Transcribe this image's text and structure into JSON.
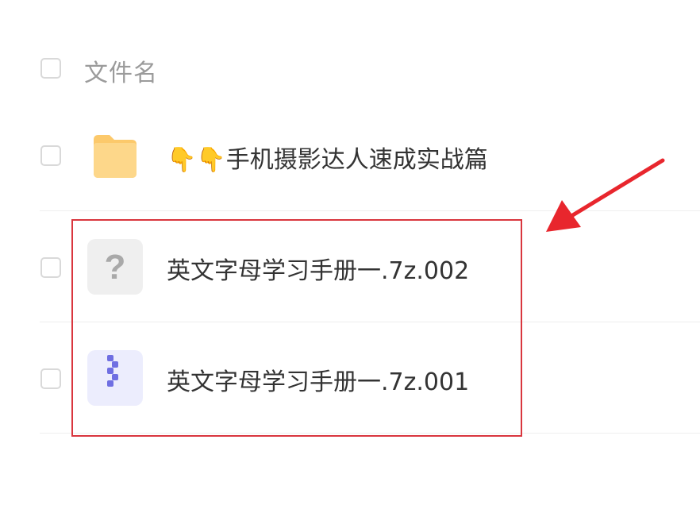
{
  "header": {
    "column_label": "文件名"
  },
  "files": [
    {
      "name": "👇👇手机摄影达人速成实战篇",
      "type": "folder-icon"
    },
    {
      "name": "英文字母学习手册一.7z.002",
      "type": "unknown-file-icon"
    },
    {
      "name": "英文字母学习手册一.7z.001",
      "type": "archive-7z-icon"
    }
  ],
  "colors": {
    "folder": "#fcc96b",
    "unknown_bg": "#efefef",
    "archive_bg": "#ecedfd",
    "archive_accent": "#6f6fe2",
    "highlight": "#d9363e",
    "arrow": "#e8262d"
  }
}
